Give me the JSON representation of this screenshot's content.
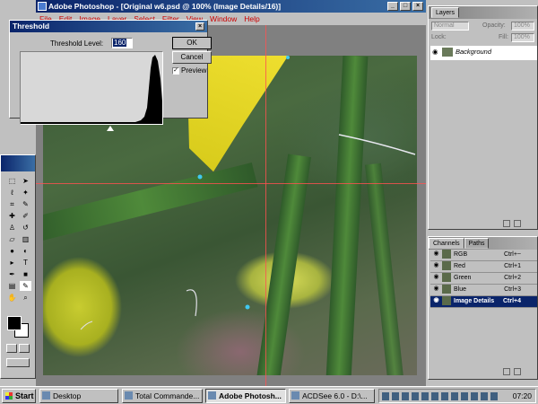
{
  "window": {
    "title": "Adobe Photoshop - [Original w6.psd @ 100% (Image Details/16)]",
    "menu": [
      "File",
      "Edit",
      "Image",
      "Layer",
      "Select",
      "Filter",
      "View",
      "Window",
      "Help"
    ]
  },
  "dialog": {
    "title": "Threshold",
    "threshold_label": "Threshold Level:",
    "threshold_value": "160",
    "ok_label": "OK",
    "cancel_label": "Cancel",
    "preview_label": "Preview",
    "preview_checked": "✓",
    "slider_position": 0.63
  },
  "layers": {
    "title": "Layers",
    "blend_mode": "Normal",
    "opacity_label": "Opacity:",
    "opacity_value": "100%",
    "lock_label": "Lock:",
    "fill_label": "Fill:",
    "fill_value": "100%",
    "layer_name": "Background"
  },
  "channels": {
    "tabs": [
      "Channels",
      "Paths"
    ],
    "rows": [
      {
        "name": "RGB",
        "shortcut": "Ctrl+~"
      },
      {
        "name": "Red",
        "shortcut": "Ctrl+1"
      },
      {
        "name": "Green",
        "shortcut": "Ctrl+2"
      },
      {
        "name": "Blue",
        "shortcut": "Ctrl+3"
      },
      {
        "name": "Image Details",
        "shortcut": "Ctrl+4"
      }
    ],
    "selected_index": 4
  },
  "taskbar": {
    "start_label": "Start",
    "tasks": [
      {
        "label": "Desktop"
      },
      {
        "label": "Total Commande..."
      },
      {
        "label": "Adobe Photosh..."
      },
      {
        "label": "ACDSee 6.0 - D:\\..."
      }
    ],
    "active_task": 2,
    "clock": "07:20"
  },
  "icons": {
    "window": [
      "photoshop-icon",
      "minimize-icon",
      "maximize-icon",
      "close-icon"
    ],
    "tools": [
      "marquee-icon",
      "move-icon",
      "lasso-icon",
      "magic-wand-icon",
      "crop-icon",
      "slice-icon",
      "healing-brush-icon",
      "brush-icon",
      "clone-stamp-icon",
      "history-brush-icon",
      "eraser-icon",
      "gradient-icon",
      "blur-icon",
      "dodge-icon",
      "path-select-icon",
      "type-icon",
      "pen-icon",
      "shape-icon",
      "notes-icon",
      "eyedropper-icon",
      "hand-icon",
      "zoom-icon"
    ]
  },
  "colors": {
    "titlebar": "#0a246a",
    "selection": "#0a246a",
    "guide": "#ff5050",
    "menu_text": "#cc0000"
  }
}
